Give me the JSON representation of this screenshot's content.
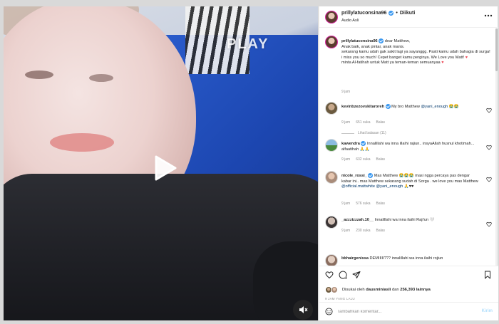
{
  "video": {
    "overlay_text": "PLAY",
    "play_icon": "play-icon",
    "sound_icon": "speaker-muted-icon"
  },
  "header": {
    "username": "prillylatuconsina96",
    "separator": "•",
    "follow_label": "Diikuti",
    "audio_label": "Audio Asli",
    "more_icon": "more-horizontal-icon"
  },
  "caption": {
    "username": "prillylatuconsina96",
    "lines": [
      "dear Matthew,",
      "Anak baik, anak pintar, anak manis.",
      "sekarang kamu udah gak sakit lagi ya sayanggg. Pasti kamu udah bahagia di surga! i miss you so much! Cepet banget kamu perginya. We Love you Matt!",
      "minta Al-fatihah untuk Matt ya teman-teman semuanyaa"
    ],
    "time": "9 jam"
  },
  "comments": [
    {
      "username": "kevinbzezovskitaroreh",
      "verified": true,
      "text_before": "My bro Matthew ",
      "mention": "@yani_enough",
      "text_after": " 😭😭",
      "time": "9 jam",
      "likes": "651 suka",
      "reply_label": "Balas",
      "view_replies": "Lihat balasan (11)"
    },
    {
      "username": "kawendra",
      "verified": true,
      "text_before": "Innalillahi wa inna illaihi rajiun.. insyaAllah husnul khotimah... alfaatihah 🙏🙏",
      "mention": "",
      "text_after": "",
      "time": "9 jam",
      "likes": "632 suka",
      "reply_label": "Balas",
      "view_replies": ""
    },
    {
      "username": "nicole_rossi_",
      "verified": true,
      "text_before": "Mas Matthew 😭😭😭 masi ngga percaya pas dengar kabar ini.. mas Matthew sekarang sudah di Sorga . we love you mas Matthew ",
      "mention": "@official.mattwhite @yani_enough",
      "text_after": " 🙏♥♥",
      "time": "9 jam",
      "likes": "576 suka",
      "reply_label": "Balas",
      "view_replies": ""
    },
    {
      "username": "_azzzizzzah.10__",
      "verified": false,
      "text_before": "Innalillahi wa inna ilaihi Raji'un 🤍",
      "mention": "",
      "text_after": "",
      "time": "9 jam",
      "likes": "230 suka",
      "reply_label": "Balas",
      "view_replies": ""
    },
    {
      "username": "bbhairgenissa",
      "verified": false,
      "text_before": "DEMIIIII??? innalillahi wa inna ilaihi rojiun",
      "mention": "",
      "text_after": "",
      "time": "",
      "likes": "",
      "reply_label": "",
      "view_replies": ""
    }
  ],
  "actions": {
    "icons": [
      "heart-icon",
      "comment-icon",
      "share-icon",
      "bookmark-icon"
    ],
    "liked_by_prefix": "Disukai oleh ",
    "liked_by_user": "dausminiasli",
    "liked_by_mid": " dan ",
    "liked_by_count": "256,393",
    "liked_by_suffix": " lainnya",
    "date": "9 JAM YANG LALU"
  },
  "comment_box": {
    "placeholder": "Tambahkan komentar...",
    "post_label": "Kirim",
    "emoji_icon": "emoji-icon"
  },
  "colors": {
    "accent_link": "#00376b",
    "verified": "#3897f0",
    "heart": "#ed4956",
    "post_disabled": "#b2dffc"
  }
}
